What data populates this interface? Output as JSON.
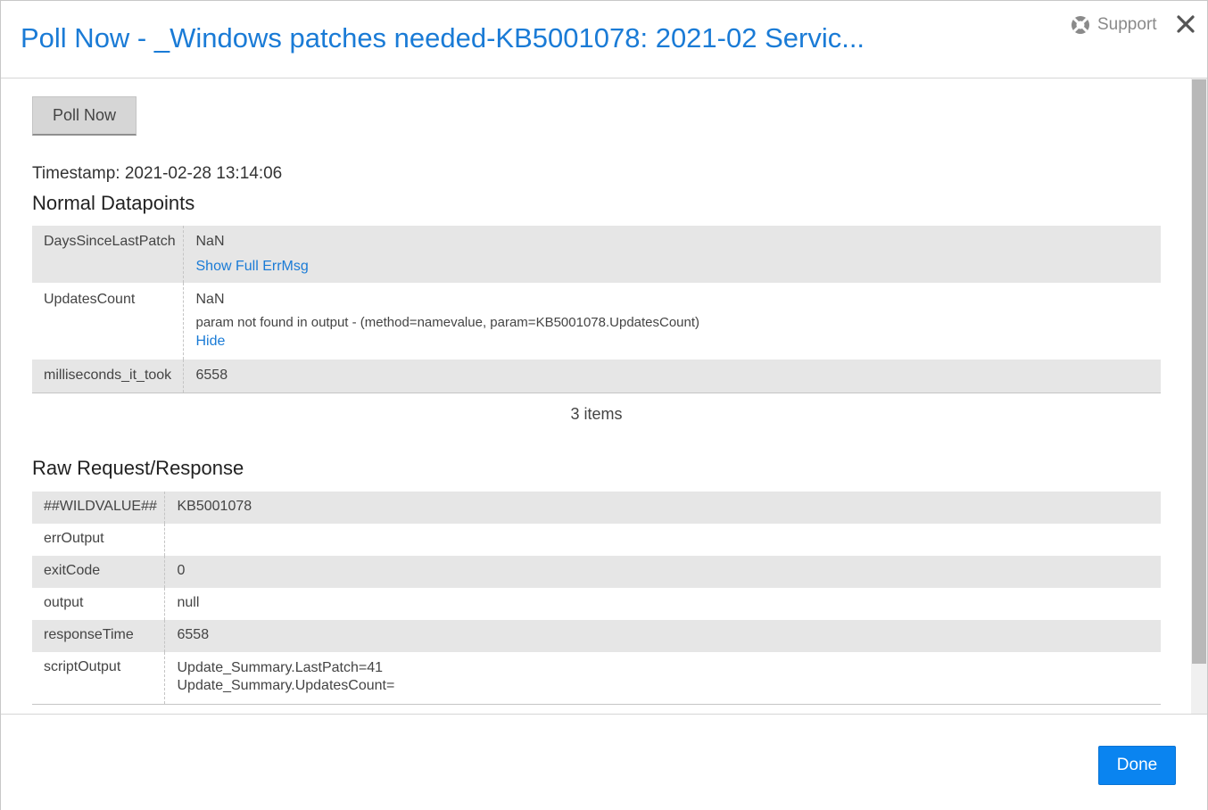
{
  "header": {
    "title": "Poll Now - _Windows patches needed-KB5001078: 2021-02 Servic...",
    "support_label": "Support",
    "support_icon": "lifebuoy-icon",
    "close_icon": "close-icon"
  },
  "toolbar": {
    "poll_label": "Poll Now"
  },
  "timestamp": "Timestamp: 2021-02-28 13:14:06",
  "normal": {
    "title": "Normal Datapoints",
    "rows": [
      {
        "key": "DaysSinceLastPatch",
        "value": "NaN",
        "link": "Show Full ErrMsg"
      },
      {
        "key": "UpdatesCount",
        "value": "NaN",
        "detail": "param not found in output - (method=namevalue, param=KB5001078.UpdatesCount)",
        "link": "Hide"
      },
      {
        "key": "milliseconds_it_took",
        "value": "6558"
      }
    ],
    "count": "3 items"
  },
  "raw": {
    "title": "Raw Request/Response",
    "rows": [
      {
        "key": "##WILDVALUE##",
        "value": "KB5001078"
      },
      {
        "key": "errOutput",
        "value": ""
      },
      {
        "key": "exitCode",
        "value": "0"
      },
      {
        "key": "output",
        "value": "null"
      },
      {
        "key": "responseTime",
        "value": "6558"
      },
      {
        "key": "scriptOutput",
        "line1": "Update_Summary.LastPatch=41",
        "line2": "Update_Summary.UpdatesCount="
      }
    ]
  },
  "footer": {
    "done_label": "Done"
  },
  "colors": {
    "accent": "#1a7bd6",
    "primary_button": "#0a84f0",
    "row_shade": "#e6e6e6"
  }
}
